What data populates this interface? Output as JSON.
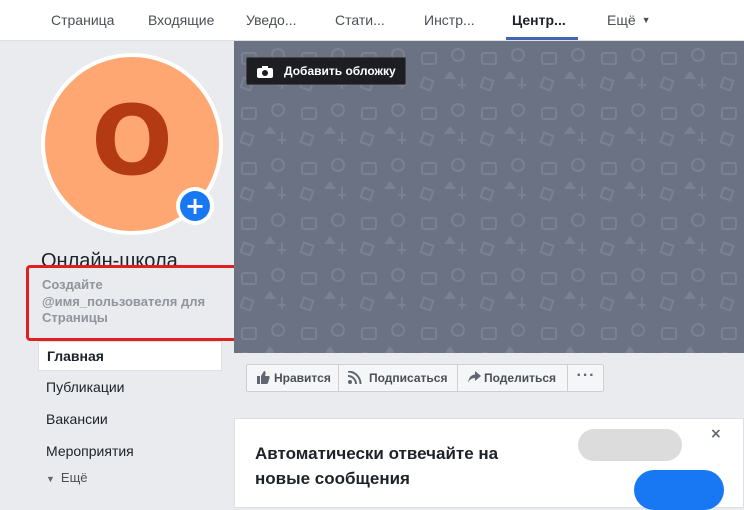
{
  "topnav": {
    "tabs": [
      {
        "label": "Страница"
      },
      {
        "label": "Входящие"
      },
      {
        "label": "Уведо..."
      },
      {
        "label": "Стати..."
      },
      {
        "label": "Инстр..."
      },
      {
        "label": "Центр..."
      },
      {
        "label": "Ещё"
      }
    ],
    "active_tab": "Центр..."
  },
  "profile": {
    "avatar_letter": "O",
    "avatar_color": "#ffa772",
    "page_name": "Онлайн-школа",
    "username_prompt": "Создайте @имя_пользователя для Страницы"
  },
  "sidebar": {
    "items": [
      {
        "label": "Главная"
      },
      {
        "label": "Публикации"
      },
      {
        "label": "Вакансии"
      },
      {
        "label": "Мероприятия"
      }
    ],
    "more_label": "Ещё"
  },
  "cover": {
    "add_cover_label": "Добавить обложку"
  },
  "actions": {
    "like_label": "Нравится",
    "follow_label": "Подписаться",
    "share_label": "Поделиться",
    "more_label": "···"
  },
  "promo": {
    "title": "Автоматически отвечайте на новые сообщения",
    "close_label": "×"
  },
  "colors": {
    "accent": "#4267b2",
    "highlight_border": "#e02020",
    "cover_bg": "#6b7283"
  }
}
